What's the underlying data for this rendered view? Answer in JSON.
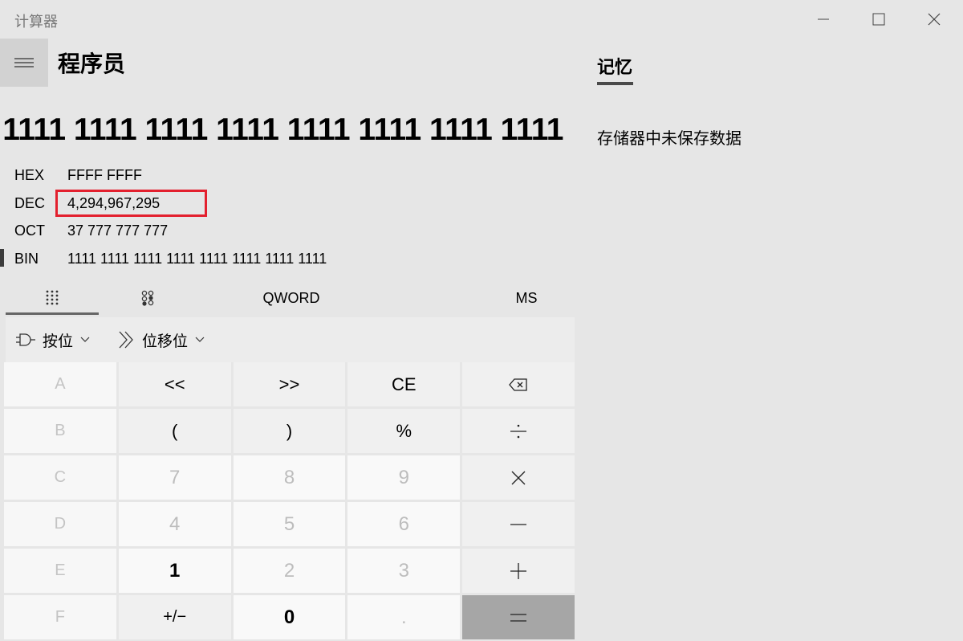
{
  "window": {
    "title": "计算器"
  },
  "header": {
    "mode_title": "程序员"
  },
  "display": {
    "main_value": "1111 1111 1111 1111 1111 1111 1111 1111"
  },
  "radix": {
    "hex": {
      "label": "HEX",
      "value": "FFFF FFFF"
    },
    "dec": {
      "label": "DEC",
      "value": "4,294,967,295"
    },
    "oct": {
      "label": "OCT",
      "value": "37 777 777 777"
    },
    "bin": {
      "label": "BIN",
      "value": "1111 1111 1111 1111 1111 1111 1111 1111"
    }
  },
  "tabs": {
    "word_size": "QWORD",
    "memory_store": "MS"
  },
  "bitwise": {
    "bitwise_label": "按位",
    "bitshift_label": "位移位"
  },
  "keys": {
    "a": "A",
    "lsh": "<<",
    "rsh": ">>",
    "ce": "CE",
    "b": "B",
    "lparen": "(",
    "rparen": ")",
    "mod": "%",
    "c": "C",
    "n7": "7",
    "n8": "8",
    "n9": "9",
    "d": "D",
    "n4": "4",
    "n5": "5",
    "n6": "6",
    "e": "E",
    "n1": "1",
    "n2": "2",
    "n3": "3",
    "f": "F",
    "negate": "+/−",
    "n0": "0",
    "dot": "."
  },
  "memory": {
    "title": "记忆",
    "empty_text": "存储器中未保存数据"
  },
  "icons": {
    "hamburger": "hamburger-icon",
    "minimize": "minimize-icon",
    "maximize": "maximize-icon",
    "close": "close-icon",
    "keypad": "keypad-icon",
    "bit_toggle": "bit-toggle-icon",
    "bitwise": "logic-gate-icon",
    "bitshift": "bitshift-icon",
    "backspace": "backspace-icon",
    "divide": "divide-icon",
    "multiply": "multiply-icon",
    "minus": "minus-icon",
    "plus": "plus-icon",
    "equals": "equals-icon"
  },
  "colors": {
    "highlight": "#e3202e",
    "equals_bg": "#a6a6a6",
    "background": "#e6e6e6"
  }
}
